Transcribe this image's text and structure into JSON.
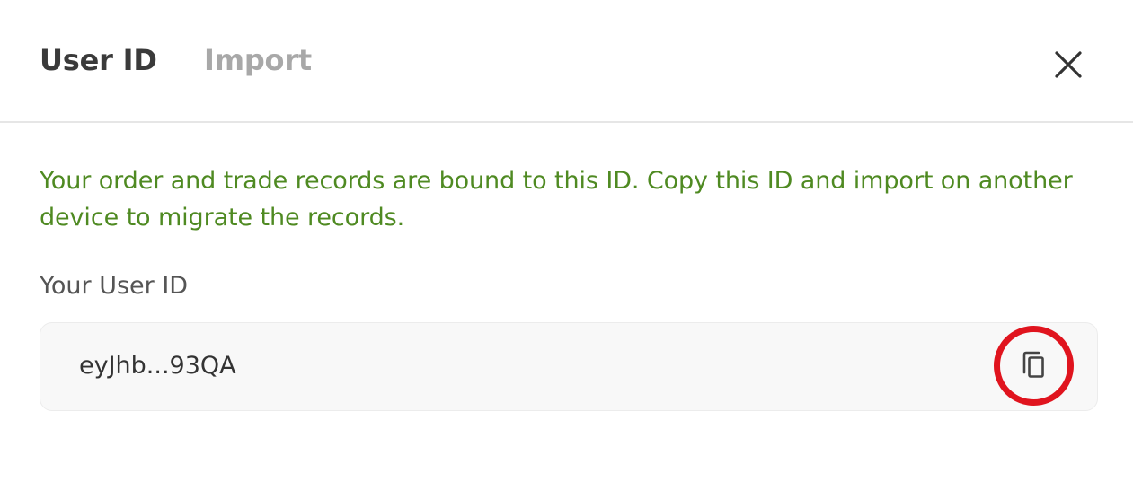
{
  "tabs": {
    "user_id": "User ID",
    "import": "Import"
  },
  "description": "Your order and trade records are bound to this ID. Copy this ID and import on another device to migrate the records.",
  "field": {
    "label": "Your User ID",
    "value": "eyJhb...93QA"
  },
  "icons": {
    "close": "close-icon",
    "copy": "copy-icon"
  },
  "colors": {
    "description_text": "#4f8a22",
    "highlight_ring": "#e0141e",
    "active_tab": "#3a3a3a",
    "inactive_tab": "#a8a8a8"
  }
}
